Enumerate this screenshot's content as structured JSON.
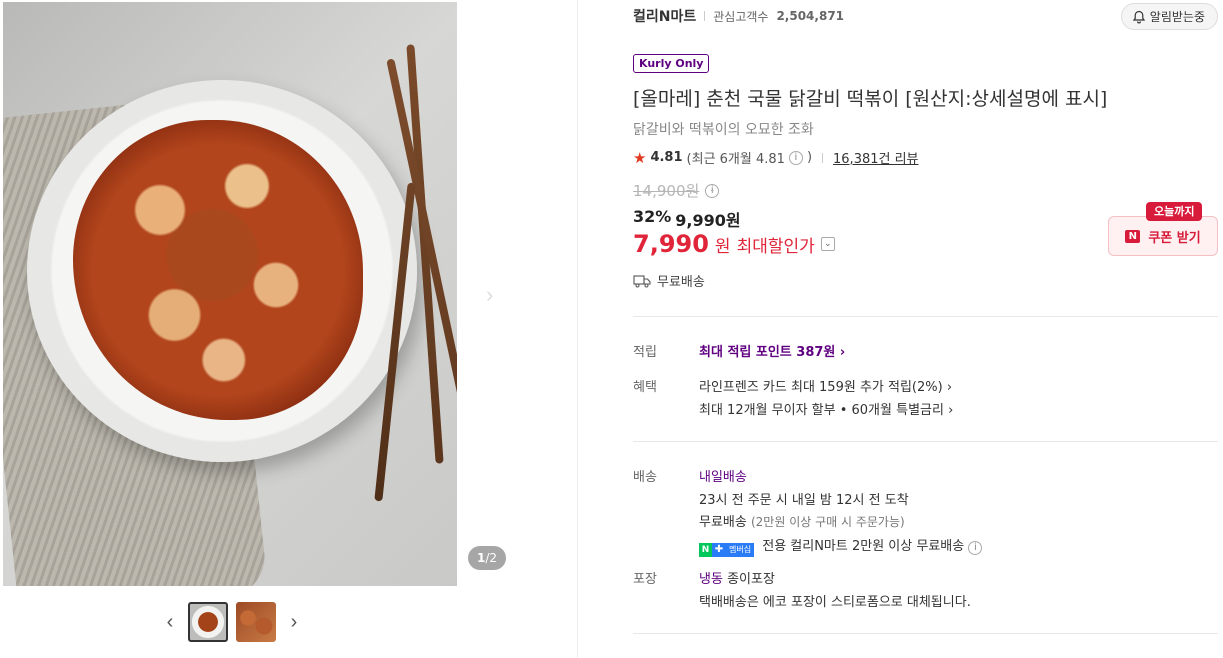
{
  "gallery": {
    "counter_current": "1",
    "counter_total": "/2",
    "prev_icon": "‹",
    "next_icon": "›"
  },
  "seller": {
    "name": "컬리N마트",
    "fans_label": "관심고객수",
    "fans_count": "2,504,871",
    "alarm_label": "알림받는중"
  },
  "product": {
    "badge": "Kurly Only",
    "title": "[올마레] 춘천 국물 닭갈비 떡볶이 [원산지:상세설명에 표시]",
    "subtitle": "닭갈비와 떡볶이의 오묘한 조화",
    "rating": "4.81",
    "rating_recent": "(최근 6개월 4.81",
    "rating_close": ")",
    "review_count": "16,381건 리뷰",
    "original_price": "14,900원",
    "discount_rate": "32%",
    "sale_price": "9,990원",
    "max_discount_price": "7,990",
    "max_discount_unit": "원",
    "max_discount_label": "최대할인가",
    "shipping_badge": "무료배송"
  },
  "coupon": {
    "tag": "오늘까지",
    "label": "쿠폰 받기"
  },
  "details": {
    "points_label": "적립",
    "points_value": "최대 적립 포인트 387원 ›",
    "benefit_label": "혜택",
    "benefit_1": "라인프렌즈 카드 최대 159원 추가 적립(2%) ›",
    "benefit_2": "최대 12개월 무이자 할부 • 60개월 특별금리 ›",
    "delivery_label": "배송",
    "delivery_type": "내일배송",
    "delivery_time": "23시 전 주문 시 내일 밤 12시 전 도착",
    "free_ship": "무료배송",
    "free_ship_note": "(2만원 이상 구매 시 주문가능)",
    "npay_text": "멤버십",
    "membership_ship": "전용 컬리N마트 2만원 이상 무료배송",
    "package_label": "포장",
    "package_type": "냉동",
    "package_material": "종이포장",
    "package_note": "택배배송은 에코 포장이 스티로폼으로 대체됩니다."
  },
  "colors": {
    "brand_purple": "#5f0080",
    "price_red": "#e0253a",
    "coupon_red": "#d81b3a"
  }
}
